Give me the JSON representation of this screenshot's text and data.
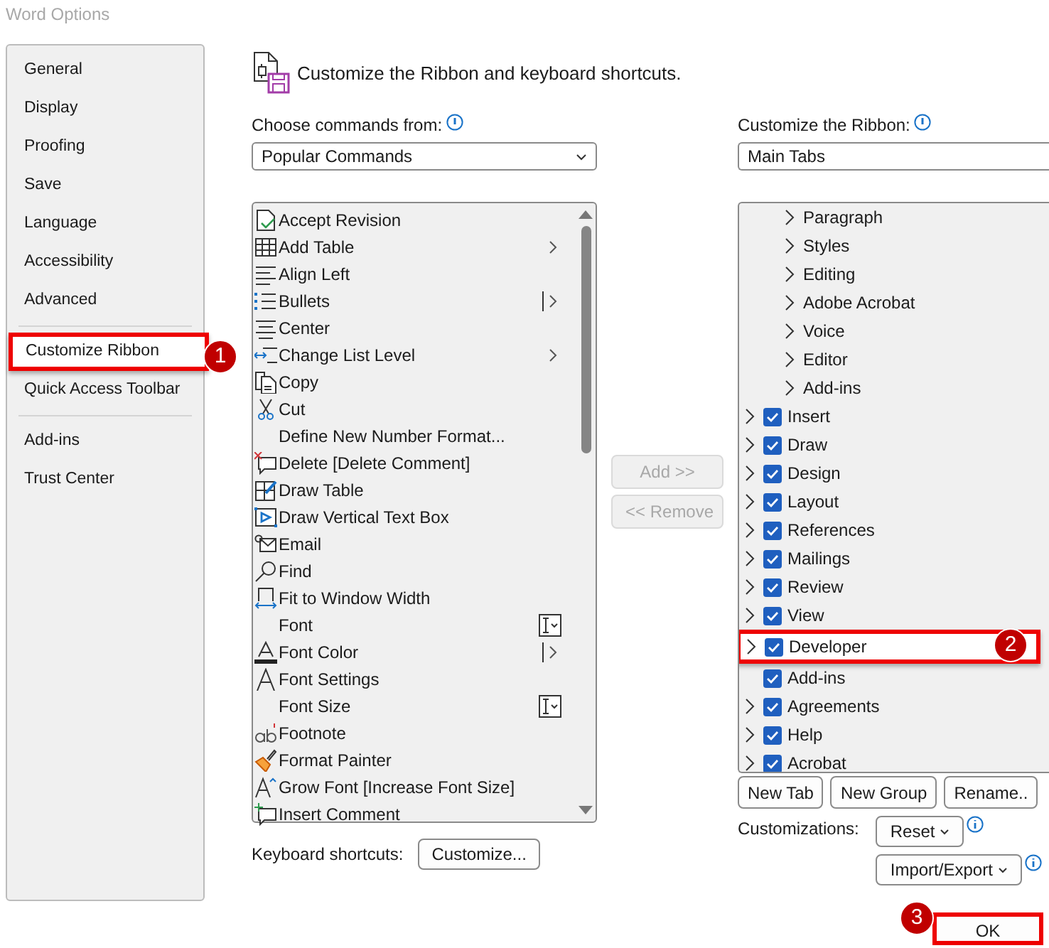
{
  "window": {
    "title": "Word Options"
  },
  "sidebar": {
    "groups": [
      [
        {
          "label": "General",
          "selected": false
        },
        {
          "label": "Display",
          "selected": false
        },
        {
          "label": "Proofing",
          "selected": false
        },
        {
          "label": "Save",
          "selected": false
        },
        {
          "label": "Language",
          "selected": false
        },
        {
          "label": "Accessibility",
          "selected": false
        },
        {
          "label": "Advanced",
          "selected": false
        }
      ],
      [
        {
          "label": "Customize Ribbon",
          "selected": true,
          "callout": "1"
        },
        {
          "label": "Quick Access Toolbar",
          "selected": false
        }
      ],
      [
        {
          "label": "Add-ins",
          "selected": false
        },
        {
          "label": "Trust Center",
          "selected": false
        }
      ]
    ]
  },
  "header": {
    "title": "Customize the Ribbon and keyboard shortcuts."
  },
  "commands": {
    "label": "Choose commands from:",
    "dropdown": "Popular Commands",
    "items": [
      {
        "label": "Accept Revision",
        "kind": "revision"
      },
      {
        "label": "Add Table",
        "kind": "table",
        "submenu": true
      },
      {
        "label": "Align Left",
        "kind": "align-left"
      },
      {
        "label": "Bullets",
        "kind": "bullets",
        "submenu": true,
        "split": true
      },
      {
        "label": "Center",
        "kind": "center"
      },
      {
        "label": "Change List Level",
        "kind": "list-level",
        "submenu": true
      },
      {
        "label": "Copy",
        "kind": "copy"
      },
      {
        "label": "Cut",
        "kind": "cut"
      },
      {
        "label": "Define New Number Format...",
        "kind": "none"
      },
      {
        "label": "Delete [Delete Comment]",
        "kind": "comment-delete"
      },
      {
        "label": "Draw Table",
        "kind": "draw-table"
      },
      {
        "label": "Draw Vertical Text Box",
        "kind": "textbox"
      },
      {
        "label": "Email",
        "kind": "email"
      },
      {
        "label": "Find",
        "kind": "find"
      },
      {
        "label": "Fit to Window Width",
        "kind": "fit-width"
      },
      {
        "label": "Font",
        "kind": "none",
        "text_dropdown": true
      },
      {
        "label": "Font Color",
        "kind": "font-color",
        "submenu": true,
        "split": true
      },
      {
        "label": "Font Settings",
        "kind": "font-letter"
      },
      {
        "label": "Font Size",
        "kind": "none",
        "text_dropdown": true
      },
      {
        "label": "Footnote",
        "kind": "footnote"
      },
      {
        "label": "Format Painter",
        "kind": "painter"
      },
      {
        "label": "Grow Font [Increase Font Size]",
        "kind": "grow-font"
      },
      {
        "label": "Insert Comment",
        "kind": "comment-add"
      }
    ]
  },
  "middle_buttons": [
    {
      "label": "Add >>",
      "disabled": true
    },
    {
      "label": "<< Remove",
      "disabled": true
    }
  ],
  "keyboard_shortcuts": {
    "label": "Keyboard shortcuts:",
    "button": "Customize..."
  },
  "ribbon": {
    "label": "Customize the Ribbon:",
    "dropdown": "Main Tabs",
    "tree": [
      {
        "kind": "hidden-parent",
        "children": [
          {
            "label": "Paragraph",
            "expandable": true
          },
          {
            "label": "Styles",
            "expandable": true
          },
          {
            "label": "Editing",
            "expandable": true
          },
          {
            "label": "Adobe Acrobat",
            "expandable": true
          },
          {
            "label": "Voice",
            "expandable": true
          },
          {
            "label": "Editor",
            "expandable": true
          },
          {
            "label": "Add-ins",
            "expandable": true
          }
        ]
      },
      {
        "label": "Insert",
        "expandable": true,
        "checked": true
      },
      {
        "label": "Draw",
        "expandable": true,
        "checked": true
      },
      {
        "label": "Design",
        "expandable": true,
        "checked": true
      },
      {
        "label": "Layout",
        "expandable": true,
        "checked": true
      },
      {
        "label": "References",
        "expandable": true,
        "checked": true
      },
      {
        "label": "Mailings",
        "expandable": true,
        "checked": true
      },
      {
        "label": "Review",
        "expandable": true,
        "checked": true
      },
      {
        "label": "View",
        "expandable": true,
        "checked": true
      },
      {
        "label": "Developer",
        "expandable": true,
        "checked": true,
        "selected": true,
        "callout": "2"
      },
      {
        "label": "Add-ins",
        "expandable": false,
        "checked": true
      },
      {
        "label": "Agreements",
        "expandable": true,
        "checked": true
      },
      {
        "label": "Help",
        "expandable": true,
        "checked": true
      },
      {
        "label": "Acrobat",
        "expandable": true,
        "checked": true
      }
    ],
    "buttons": [
      "New Tab",
      "New Group",
      "Rename.."
    ],
    "customizations": {
      "label": "Customizations:",
      "reset": "Reset",
      "import_export": "Import/Export"
    }
  },
  "ok_button": {
    "label": "OK",
    "callout": "3"
  }
}
